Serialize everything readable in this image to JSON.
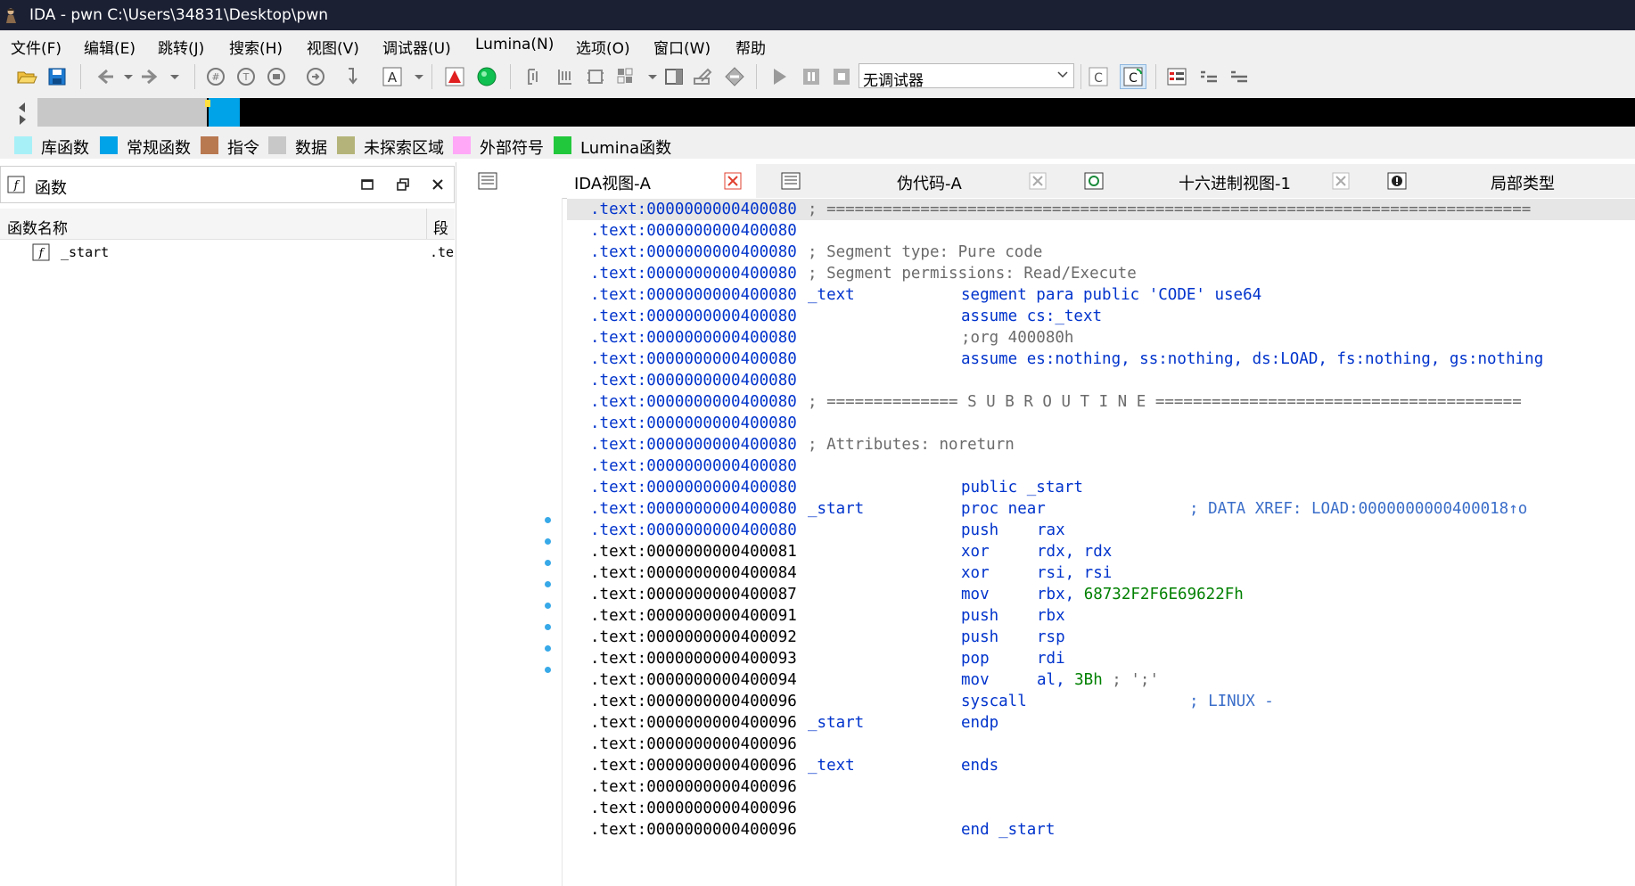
{
  "window": {
    "title": "IDA - pwn C:\\Users\\34831\\Desktop\\pwn"
  },
  "menu": [
    "文件(F)",
    "编辑(E)",
    "跳转(J)",
    "搜索(H)",
    "视图(V)",
    "调试器(U)",
    "Lumina(N)",
    "选项(O)",
    "窗口(W)",
    "帮助"
  ],
  "toolbar": {
    "debugger_select": "无调试器",
    "icons": [
      "open-icon",
      "save-icon",
      "back-icon",
      "forward-icon",
      "hex-icon",
      "text-icon",
      "struct-icon",
      "jump-icon",
      "step-icon",
      "font-icon",
      "red-triangle-icon",
      "green-circle-icon",
      "graph-icon",
      "list-icon",
      "flow-icon",
      "grid-icon",
      "window-icon",
      "edit-icon",
      "diamond-icon",
      "run-icon",
      "pause-icon",
      "stop-icon",
      "c-icon",
      "c-refresh-icon",
      "color-icon",
      "indent-icon",
      "outdent-icon"
    ]
  },
  "legend": [
    {
      "label": "库函数",
      "color": "#a8f0f8"
    },
    {
      "label": "常规函数",
      "color": "#00a2e8"
    },
    {
      "label": "指令",
      "color": "#b87850"
    },
    {
      "label": "数据",
      "color": "#c8c8c8"
    },
    {
      "label": "未探索区域",
      "color": "#b4b47a"
    },
    {
      "label": "外部符号",
      "color": "#ffa8f8"
    },
    {
      "label": "Lumina函数",
      "color": "#22c83c"
    }
  ],
  "functions_panel": {
    "title": "函数",
    "col_name": "函数名称",
    "col_segment": "段",
    "rows": [
      {
        "name": "_start",
        "segment": ".text"
      }
    ]
  },
  "tabs": [
    {
      "label": "IDA视图-A",
      "active": true
    },
    {
      "label": "伪代码-A",
      "active": false
    },
    {
      "label": "十六进制视图-1",
      "active": false
    },
    {
      "label": "局部类型",
      "active": false
    }
  ],
  "disasm": [
    {
      "addr": ".text:0000000000400080",
      "addr_color": "blue",
      "comment": "; ==========================================================================="
    },
    {
      "addr": ".text:0000000000400080",
      "addr_color": "blue"
    },
    {
      "addr": ".text:0000000000400080",
      "addr_color": "blue",
      "comment": "; Segment type: Pure code"
    },
    {
      "addr": ".text:0000000000400080",
      "addr_color": "blue",
      "comment": "; Segment permissions: Read/Execute"
    },
    {
      "addr": ".text:0000000000400080",
      "addr_color": "blue",
      "label": "_text",
      "mnemonic": "segment para public 'CODE' use64"
    },
    {
      "addr": ".text:0000000000400080",
      "addr_color": "blue",
      "mnemonic": "assume cs:_text"
    },
    {
      "addr": ".text:0000000000400080",
      "addr_color": "blue",
      "mnemonic_gray": ";org 400080h"
    },
    {
      "addr": ".text:0000000000400080",
      "addr_color": "blue",
      "mnemonic": "assume es:nothing, ss:nothing, ds:LOAD, fs:nothing, gs:nothing"
    },
    {
      "addr": ".text:0000000000400080",
      "addr_color": "blue"
    },
    {
      "addr": ".text:0000000000400080",
      "addr_color": "blue",
      "comment": "; ============== S U B R O U T I N E ======================================="
    },
    {
      "addr": ".text:0000000000400080",
      "addr_color": "blue"
    },
    {
      "addr": ".text:0000000000400080",
      "addr_color": "blue",
      "comment": "; Attributes: noreturn"
    },
    {
      "addr": ".text:0000000000400080",
      "addr_color": "blue"
    },
    {
      "addr": ".text:0000000000400080",
      "addr_color": "blue",
      "mnemonic": "public _start"
    },
    {
      "addr": ".text:0000000000400080",
      "addr_color": "blue",
      "label": "_start",
      "mnemonic": "proc near",
      "xref": "; DATA XREF: LOAD:0000000000400018↑o"
    },
    {
      "addr": ".text:0000000000400080",
      "addr_color": "blue",
      "mnemonic": "push",
      "operand": "rax"
    },
    {
      "addr": ".text:0000000000400081",
      "addr_color": "black",
      "mnemonic": "xor",
      "operand": "rdx, rdx"
    },
    {
      "addr": ".text:0000000000400084",
      "addr_color": "black",
      "mnemonic": "xor",
      "operand": "rsi, rsi"
    },
    {
      "addr": ".text:0000000000400087",
      "addr_color": "black",
      "mnemonic": "mov",
      "operand": "rbx,",
      "operand_green": "68732F2F6E69622Fh"
    },
    {
      "addr": ".text:0000000000400091",
      "addr_color": "black",
      "mnemonic": "push",
      "operand": "rbx"
    },
    {
      "addr": ".text:0000000000400092",
      "addr_color": "black",
      "mnemonic": "push",
      "operand": "rsp"
    },
    {
      "addr": ".text:0000000000400093",
      "addr_color": "black",
      "mnemonic": "pop",
      "operand": "rdi"
    },
    {
      "addr": ".text:0000000000400094",
      "addr_color": "black",
      "mnemonic": "mov",
      "operand": "al,",
      "operand_green": "3Bh",
      "operand_tail": "; ';'"
    },
    {
      "addr": ".text:0000000000400096",
      "addr_color": "black",
      "mnemonic": "syscall",
      "xref": "; LINUX -"
    },
    {
      "addr": ".text:0000000000400096",
      "addr_color": "black",
      "label": "_start",
      "mnemonic": "endp"
    },
    {
      "addr": ".text:0000000000400096",
      "addr_color": "black"
    },
    {
      "addr": ".text:0000000000400096",
      "addr_color": "black",
      "label": "_text",
      "mnemonic": "ends"
    },
    {
      "addr": ".text:0000000000400096",
      "addr_color": "black"
    },
    {
      "addr": ".text:0000000000400096",
      "addr_color": "black"
    },
    {
      "addr": ".text:0000000000400096",
      "addr_color": "black",
      "mnemonic": "end _start"
    }
  ]
}
